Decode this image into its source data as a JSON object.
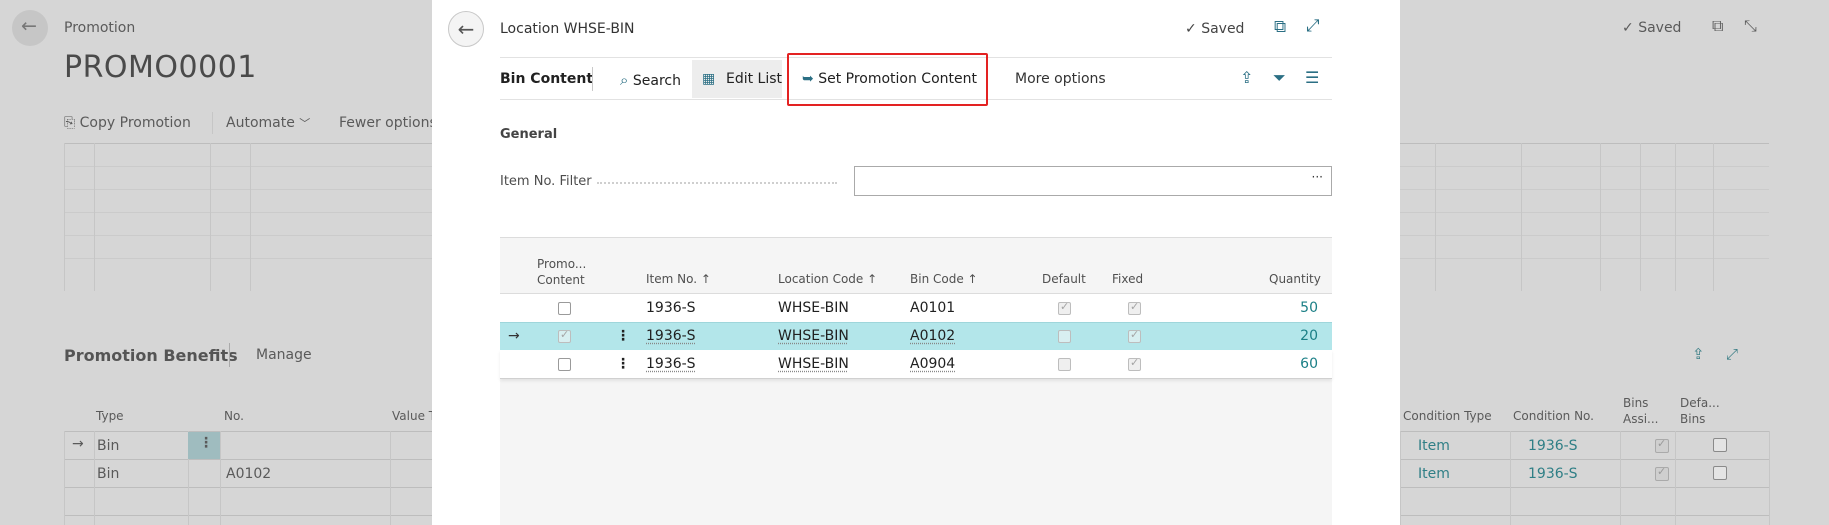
{
  "background": {
    "breadcrumb": "Promotion",
    "title": "PROMO0001",
    "saved": "Saved",
    "actions": {
      "copy_promotion": "Copy Promotion",
      "automate": "Automate",
      "fewer_options": "Fewer options"
    },
    "benefits": {
      "title": "Promotion Benefits",
      "manage": "Manage"
    },
    "benefits_columns": {
      "type": "Type",
      "no": "No.",
      "value_type": "Value Ty",
      "condition_type": "Condition Type",
      "condition_no": "Condition No.",
      "bins_assigned": [
        "Bins",
        "Assi..."
      ],
      "default_bins": [
        "Defa...",
        "Bins"
      ]
    },
    "benefits_rows": [
      {
        "type": "Bin",
        "no": "",
        "condition_type": "Item",
        "condition_no": "1936-S"
      },
      {
        "type": "Bin",
        "no": "A0102",
        "condition_type": "Item",
        "condition_no": "1936-S"
      }
    ]
  },
  "modal": {
    "title": "Location WHSE-BIN",
    "saved": "Saved",
    "toolbar": {
      "tab": "Bin Content",
      "search": "Search",
      "edit_list": "Edit List",
      "set_promotion_content": "Set Promotion Content",
      "more_options": "More options"
    },
    "general": {
      "heading": "General",
      "item_no_filter_label": "Item No. Filter",
      "item_no_filter_value": "",
      "ellipsis": "···"
    },
    "columns": {
      "promo_content": [
        "Promo...",
        "Content"
      ],
      "item_no": "Item No.",
      "location_code": "Location Code",
      "bin_code": "Bin Code",
      "default": "Default",
      "fixed": "Fixed",
      "quantity": "Quantity"
    },
    "rows": [
      {
        "promo": false,
        "item_no": "1936-S",
        "location": "WHSE-BIN",
        "bin": "A0101",
        "default": true,
        "fixed": true,
        "quantity": "50"
      },
      {
        "promo": true,
        "item_no": "1936-S",
        "location": "WHSE-BIN",
        "bin": "A0102",
        "default": false,
        "fixed": true,
        "quantity": "20"
      },
      {
        "promo": false,
        "item_no": "1936-S",
        "location": "WHSE-BIN",
        "bin": "A0904",
        "default": false,
        "fixed": true,
        "quantity": "60"
      }
    ]
  },
  "colors": {
    "accent": "#1b7f86",
    "selected_row": "#b3e6ea",
    "highlight_box": "#e32222",
    "arrow": "#e32222"
  }
}
